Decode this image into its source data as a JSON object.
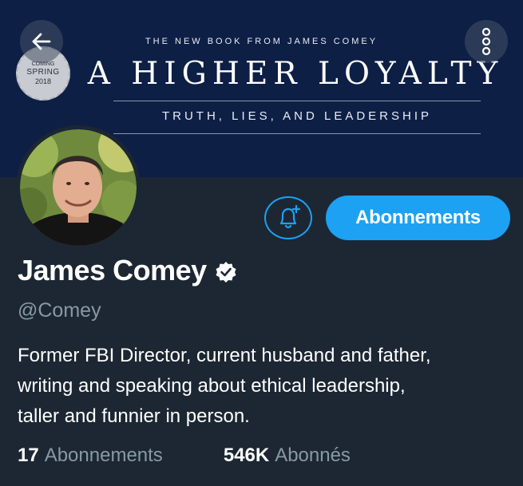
{
  "banner": {
    "kicker": "THE NEW BOOK FROM JAMES COMEY",
    "title": "A HIGHER LOYALTY",
    "subtitle": "TRUTH, LIES, AND LEADERSHIP",
    "seal": {
      "line1": "COMING",
      "line2": "SPRING",
      "line3": "2018"
    },
    "background_color": "#0d1f45"
  },
  "topbar": {
    "back_icon": "arrow-left-icon",
    "more_icon": "more-vertical-icon"
  },
  "actions": {
    "bell_icon": "bell-plus-icon",
    "follow_label": "Abonnements",
    "accent_color": "#1da1f2"
  },
  "profile": {
    "name": "James Comey",
    "verified_icon": "verified-badge-icon",
    "handle": "@Comey",
    "bio_lines": [
      "Former FBI Director, current husband and father,",
      "writing and speaking about ethical leadership,",
      "taller and funnier in person."
    ]
  },
  "stats": {
    "following_count": "17",
    "following_label": "Abonnements",
    "followers_count": "546K",
    "followers_label": "Abonnés"
  },
  "theme": {
    "background": "#1c2733",
    "text": "#ffffff",
    "muted_text": "#8899a6"
  }
}
